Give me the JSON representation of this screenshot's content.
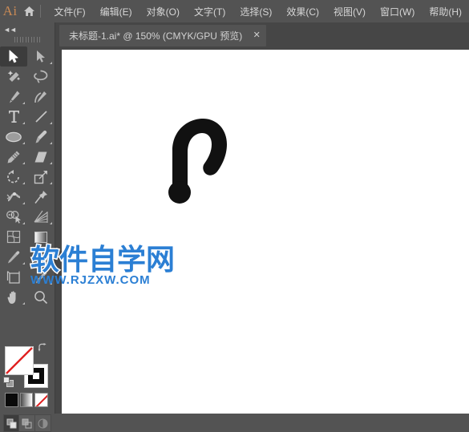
{
  "app": {
    "logo_text": "Ai",
    "home_icon": "home-icon"
  },
  "menubar": {
    "items": [
      {
        "label": "文件(F)",
        "name": "menu-file"
      },
      {
        "label": "编辑(E)",
        "name": "menu-edit"
      },
      {
        "label": "对象(O)",
        "name": "menu-object"
      },
      {
        "label": "文字(T)",
        "name": "menu-type"
      },
      {
        "label": "选择(S)",
        "name": "menu-select"
      },
      {
        "label": "效果(C)",
        "name": "menu-effect"
      },
      {
        "label": "视图(V)",
        "name": "menu-view"
      },
      {
        "label": "窗口(W)",
        "name": "menu-window"
      },
      {
        "label": "帮助(H)",
        "name": "menu-help"
      }
    ]
  },
  "tabbar": {
    "tabs": [
      {
        "label": "未标题-1.ai* @ 150% (CMYK/GPU 预览)",
        "close_label": "✕",
        "active": true,
        "document_name": "未标题-1.ai",
        "modified": "*",
        "zoom": "150%",
        "color_mode": "CMYK",
        "render_mode": "GPU 预览"
      }
    ]
  },
  "toolpanel": {
    "collapse_label": "◄◄",
    "tools": [
      {
        "name": "selection-tool",
        "label": "选择工具",
        "selected": true,
        "has_flyout": false
      },
      {
        "name": "direct-selection-tool",
        "label": "直接选择工具",
        "selected": false,
        "has_flyout": true
      },
      {
        "name": "magic-wand-tool",
        "label": "魔棒工具",
        "selected": false,
        "has_flyout": false
      },
      {
        "name": "lasso-tool",
        "label": "套索工具",
        "selected": false,
        "has_flyout": false
      },
      {
        "name": "pen-tool",
        "label": "钢笔工具",
        "selected": false,
        "has_flyout": true
      },
      {
        "name": "curvature-tool",
        "label": "曲率工具",
        "selected": false,
        "has_flyout": false
      },
      {
        "name": "type-tool",
        "label": "文字工具",
        "selected": false,
        "has_flyout": true
      },
      {
        "name": "line-segment-tool",
        "label": "直线段工具",
        "selected": false,
        "has_flyout": true
      },
      {
        "name": "ellipse-tool",
        "label": "椭圆工具",
        "selected": false,
        "has_flyout": true
      },
      {
        "name": "paintbrush-tool",
        "label": "画笔工具",
        "selected": false,
        "has_flyout": true
      },
      {
        "name": "pencil-tool",
        "label": "铅笔工具",
        "selected": false,
        "has_flyout": true
      },
      {
        "name": "eraser-tool",
        "label": "橡皮擦工具",
        "selected": false,
        "has_flyout": true
      },
      {
        "name": "rotate-tool",
        "label": "旋转工具",
        "selected": false,
        "has_flyout": true
      },
      {
        "name": "scale-tool",
        "label": "比例缩放工具",
        "selected": false,
        "has_flyout": true
      },
      {
        "name": "width-tool",
        "label": "宽度工具",
        "selected": false,
        "has_flyout": true
      },
      {
        "name": "free-transform-tool",
        "label": "自由变换工具",
        "selected": false,
        "has_flyout": false
      },
      {
        "name": "shape-builder-tool",
        "label": "形状生成器工具",
        "selected": false,
        "has_flyout": true
      },
      {
        "name": "perspective-grid-tool",
        "label": "透视网格工具",
        "selected": false,
        "has_flyout": true
      },
      {
        "name": "mesh-tool",
        "label": "网格工具",
        "selected": false,
        "has_flyout": false
      },
      {
        "name": "gradient-tool",
        "label": "渐变工具",
        "selected": false,
        "has_flyout": false
      },
      {
        "name": "eyedropper-tool",
        "label": "吸管工具",
        "selected": false,
        "has_flyout": true
      },
      {
        "name": "blend-tool",
        "label": "混合工具",
        "selected": false,
        "has_flyout": false
      },
      {
        "name": "symbol-sprayer-tool",
        "label": "符号喷枪工具",
        "selected": false,
        "has_flyout": true
      },
      {
        "name": "column-graph-tool",
        "label": "柱形图工具",
        "selected": false,
        "has_flyout": true
      },
      {
        "name": "artboard-tool",
        "label": "画板工具",
        "selected": false,
        "has_flyout": false
      },
      {
        "name": "slice-tool",
        "label": "切片工具",
        "selected": false,
        "has_flyout": true
      },
      {
        "name": "hand-tool",
        "label": "抓手工具",
        "selected": false,
        "has_flyout": true
      },
      {
        "name": "zoom-tool",
        "label": "缩放工具",
        "selected": false,
        "has_flyout": false
      }
    ],
    "fill_stroke": {
      "fill_name": "fill-swatch",
      "fill_value": "无",
      "stroke_name": "stroke-swatch",
      "stroke_value": "黑色",
      "swap_name": "swap-fill-stroke-icon",
      "default_name": "default-fill-stroke-icon"
    },
    "color_modes": [
      {
        "name": "color-swatch-button",
        "label": "颜色",
        "kind": "black"
      },
      {
        "name": "gradient-swatch-button",
        "label": "渐变",
        "kind": "grad"
      },
      {
        "name": "none-swatch-button",
        "label": "无",
        "kind": "none"
      }
    ],
    "draw_modes": [
      {
        "name": "draw-normal-button",
        "label": "正常绘图",
        "active": true
      },
      {
        "name": "draw-behind-button",
        "label": "背面绘图",
        "active": false
      },
      {
        "name": "draw-inside-button",
        "label": "内部绘图",
        "active": false
      }
    ]
  },
  "canvas": {
    "artboard_name": "artboard",
    "artwork_name": "hook-shape-path",
    "artwork_fill": "#111111",
    "background": "#464646"
  },
  "watermark": {
    "cn_text": "软件自学网",
    "en_text": "WWW.RJZXW.COM",
    "color": "#2b7fd4"
  }
}
